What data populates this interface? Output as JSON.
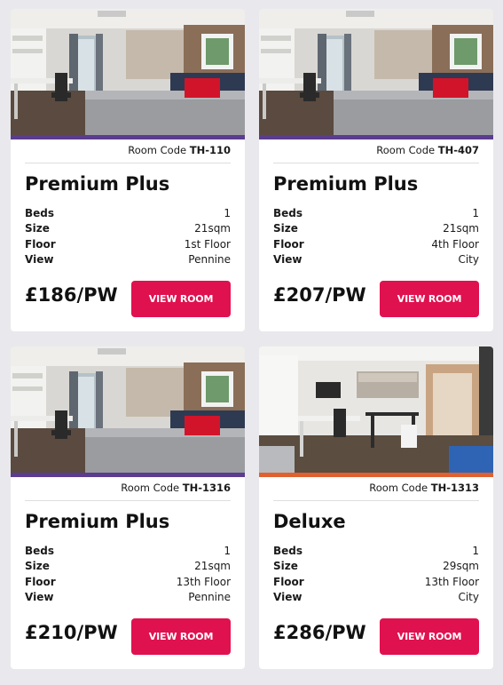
{
  "code_prefix": "Room Code",
  "spec_labels": {
    "beds": "Beds",
    "size": "Size",
    "floor": "Floor",
    "view": "View"
  },
  "button_label": "VIEW ROOM",
  "cards": [
    {
      "code": "TH-110",
      "title": "Premium Plus",
      "beds": "1",
      "size": "21sqm",
      "floor": "1st Floor",
      "view": "Pennine",
      "price": "£186/PW",
      "stripe_color": "#5b3d8f",
      "photo": "bedroom"
    },
    {
      "code": "TH-407",
      "title": "Premium Plus",
      "beds": "1",
      "size": "21sqm",
      "floor": "4th Floor",
      "view": "City",
      "price": "£207/PW",
      "stripe_color": "#5b3d8f",
      "photo": "bedroom"
    },
    {
      "code": "TH-1316",
      "title": "Premium Plus",
      "beds": "1",
      "size": "21sqm",
      "floor": "13th Floor",
      "view": "Pennine",
      "price": "£210/PW",
      "stripe_color": "#5b3d8f",
      "photo": "bedroom"
    },
    {
      "code": "TH-1313",
      "title": "Deluxe",
      "beds": "1",
      "size": "29sqm",
      "floor": "13th Floor",
      "view": "City",
      "price": "£286/PW",
      "stripe_color": "#e0602f",
      "photo": "studio"
    }
  ]
}
